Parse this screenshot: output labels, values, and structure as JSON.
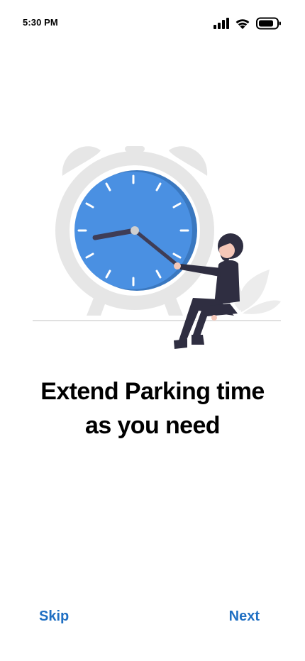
{
  "status_bar": {
    "time": "5:30 PM",
    "icons": [
      "cellular-signal-icon",
      "wifi-icon",
      "battery-icon"
    ]
  },
  "illustration": {
    "name": "woman-pulling-clock-hand",
    "colors": {
      "clock_ring": "#e6e6e6",
      "clock_face": "#4a90e2",
      "clock_face_shadow": "#3a78c0",
      "clock_hand": "#3f3d56",
      "person_outfit": "#2f2e41",
      "ground_line": "#e0e0e0"
    }
  },
  "onboarding": {
    "headline_line1": "Extend Parking time",
    "headline_line2": "as you need"
  },
  "footer": {
    "skip_label": "Skip",
    "next_label": "Next"
  },
  "theme": {
    "accent": "#1f6fc3",
    "text": "#000000",
    "background": "#ffffff"
  }
}
